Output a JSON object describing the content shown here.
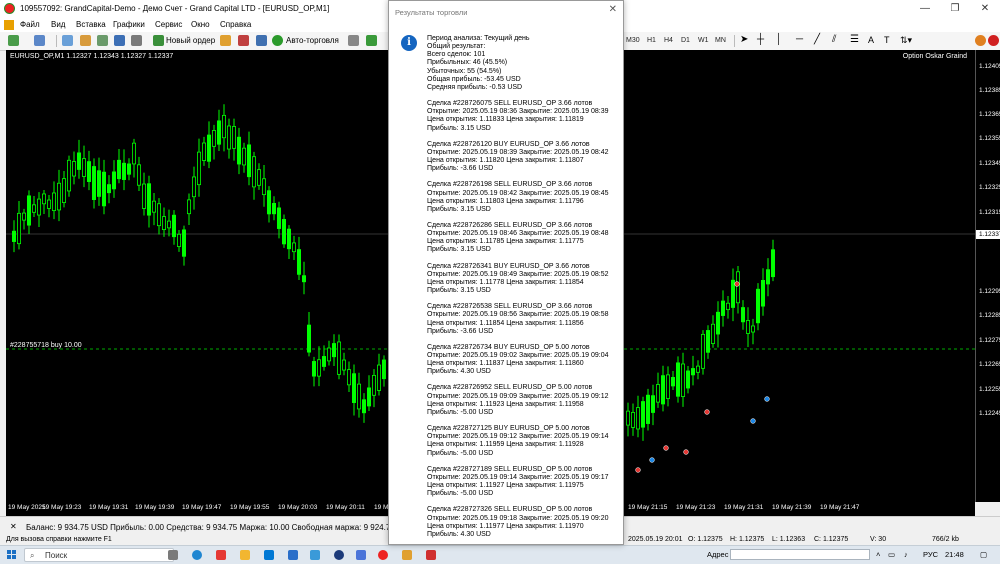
{
  "window": {
    "title": "109557092: GrandCapital-Demo - Демо Счет - Grand Capital LTD - [EURUSD_OP,M1]",
    "minimize": "—",
    "restore": "❐",
    "close": "✕"
  },
  "menu": [
    "Файл",
    "Вид",
    "Вставка",
    "Графики",
    "Сервис",
    "Окно",
    "Справка"
  ],
  "toolbar": {
    "new_order": "Новый ордер",
    "auto_trading": "Авто-торговля",
    "timeframes": [
      "M30",
      "H1",
      "H4",
      "D1",
      "W1",
      "MN"
    ]
  },
  "chart": {
    "symbol_label": "EURUSD_OP,M1  1.12327 1.12343 1.12327 1.12337",
    "indicator": "Option Oskar Graind",
    "order_label": "#228755718 buy 10.00",
    "price_labels": [
      "1.12405",
      "1.12385",
      "1.12365",
      "1.12355",
      "1.12345",
      "1.12325",
      "1.12315",
      "1.12305",
      "1.12295",
      "1.12285",
      "1.12275",
      "1.12265",
      "1.12255",
      "1.12245"
    ],
    "current_price": "1.12337",
    "time_labels_left": [
      "19 May 2025",
      "19 May 19:23",
      "19 May 19:31",
      "19 May 19:39",
      "19 May 19:47",
      "19 May 19:55",
      "19 May 20:03",
      "19 May 20:11",
      "19 May 20:19"
    ],
    "time_labels_right": [
      "19 May 21:15",
      "19 May 21:23",
      "19 May 21:31",
      "19 May 21:39",
      "19 May 21:47"
    ],
    "colors": {
      "background": "#000000",
      "candle": "#00ff00",
      "order_line": "#00aa00"
    }
  },
  "terminal": {
    "summary": "Баланс: 9 934.75 USD  Прибыль: 0.00  Средства: 9 934.75  Маржа: 10.00  Свободная маржа: 9 924.75  Уровень"
  },
  "status": {
    "help": "Для вызова справки нажмите F1",
    "datetime": "2025.05.19 20:01",
    "o": "O: 1.12375",
    "h": "H: 1.12375",
    "l": "L: 1.12363",
    "c": "C: 1.12375",
    "v": "V: 30",
    "traffic": "766/2 kb"
  },
  "taskbar": {
    "search": "Поиск",
    "address": "Адрес",
    "lang": "РУС",
    "time": "21:48"
  },
  "dialog": {
    "title": "Результаты торговли",
    "close": "✕",
    "summary": [
      "Период анализа: Текущий день",
      "Общий результат:",
      "Всего сделок: 101",
      "Прибыльных: 46 (45.5%)",
      "Убыточных: 55 (54.5%)",
      "Общая прибыль: -53.45 USD",
      "Средняя прибыль: -0.53 USD"
    ],
    "trades": [
      [
        "Сделка #228726075 SELL EURUSD_OP 3.66 лотов",
        "Открытие: 2025.05.19 08:36 Закрытие: 2025.05.19 08:39",
        "Цена открытия: 1.11833 Цена закрытия: 1.11819",
        "Прибыль: 3.15 USD"
      ],
      [
        "Сделка #228726120 BUY EURUSD_OP 3.66 лотов",
        "Открытие: 2025.05.19 08:39 Закрытие: 2025.05.19 08:42",
        "Цена открытия: 1.11820 Цена закрытия: 1.11807",
        "Прибыль: -3.66 USD"
      ],
      [
        "Сделка #228726198 SELL EURUSD_OP 3.66 лотов",
        "Открытие: 2025.05.19 08:42 Закрытие: 2025.05.19 08:45",
        "Цена открытия: 1.11803 Цена закрытия: 1.11796",
        "Прибыль: 3.15 USD"
      ],
      [
        "Сделка #228726286 SELL EURUSD_OP 3.66 лотов",
        "Открытие: 2025.05.19 08:46 Закрытие: 2025.05.19 08:48",
        "Цена открытия: 1.11785 Цена закрытия: 1.11775",
        "Прибыль: 3.15 USD"
      ],
      [
        "Сделка #228726341 BUY EURUSD_OP 3.66 лотов",
        "Открытие: 2025.05.19 08:49 Закрытие: 2025.05.19 08:52",
        "Цена открытия: 1.11778 Цена закрытия: 1.11854",
        "Прибыль: 3.15 USD"
      ],
      [
        "Сделка #228726538 SELL EURUSD_OP 3.66 лотов",
        "Открытие: 2025.05.19 08:56 Закрытие: 2025.05.19 08:58",
        "Цена открытия: 1.11854 Цена закрытия: 1.11856",
        "Прибыль: -3.66 USD"
      ],
      [
        "Сделка #228726734 BUY EURUSD_OP 5.00 лотов",
        "Открытие: 2025.05.19 09:02 Закрытие: 2025.05.19 09:04",
        "Цена открытия: 1.11837 Цена закрытия: 1.11860",
        "Прибыль: 4.30 USD"
      ],
      [
        "Сделка #228726952 SELL EURUSD_OP 5.00 лотов",
        "Открытие: 2025.05.19 09:09 Закрытие: 2025.05.19 09:12",
        "Цена открытия: 1.11923 Цена закрытия: 1.11958",
        "Прибыль: -5.00 USD"
      ],
      [
        "Сделка #228727125 BUY EURUSD_OP 5.00 лотов",
        "Открытие: 2025.05.19 09:12 Закрытие: 2025.05.19 09:14",
        "Цена открытия: 1.11959 Цена закрытия: 1.11928",
        "Прибыль: -5.00 USD"
      ],
      [
        "Сделка #228727189 SELL EURUSD_OP 5.00 лотов",
        "Открытие: 2025.05.19 09:14 Закрытие: 2025.05.19 09:17",
        "Цена открытия: 1.11927 Цена закрытия: 1.11975",
        "Прибыль: -5.00 USD"
      ],
      [
        "Сделка #228727326 SELL EURUSD_OP 5.00 лотов",
        "Открытие: 2025.05.19 09:18 Закрытие: 2025.05.19 09:20",
        "Цена открытия: 1.11977 Цена закрытия: 1.11970",
        "Прибыль: 4.30 USD"
      ]
    ]
  }
}
